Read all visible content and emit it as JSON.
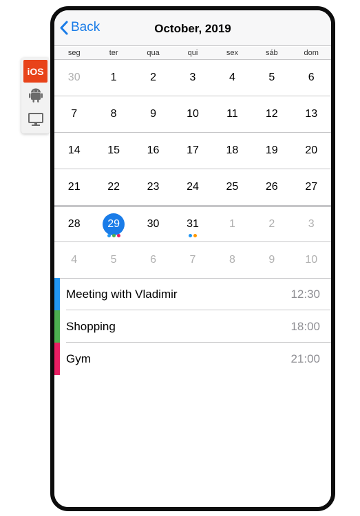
{
  "platforms": [
    {
      "label": "iOS",
      "icon": "ios-label",
      "active": true
    },
    {
      "label": "",
      "icon": "android-icon",
      "active": false
    },
    {
      "label": "",
      "icon": "desktop-icon",
      "active": false
    }
  ],
  "navbar": {
    "back_label": "Back",
    "title": "October, 2019"
  },
  "week_days": [
    "seg",
    "ter",
    "qua",
    "qui",
    "sex",
    "sáb",
    "dom"
  ],
  "calendar": {
    "selected_day": "29",
    "rows": [
      [
        {
          "d": "30",
          "other": true
        },
        {
          "d": "1"
        },
        {
          "d": "2"
        },
        {
          "d": "3"
        },
        {
          "d": "4"
        },
        {
          "d": "5"
        },
        {
          "d": "6"
        }
      ],
      [
        {
          "d": "7"
        },
        {
          "d": "8"
        },
        {
          "d": "9"
        },
        {
          "d": "10"
        },
        {
          "d": "11"
        },
        {
          "d": "12"
        },
        {
          "d": "13"
        }
      ],
      [
        {
          "d": "14"
        },
        {
          "d": "15"
        },
        {
          "d": "16"
        },
        {
          "d": "17"
        },
        {
          "d": "18"
        },
        {
          "d": "19"
        },
        {
          "d": "20"
        }
      ],
      [
        {
          "d": "21"
        },
        {
          "d": "22"
        },
        {
          "d": "23"
        },
        {
          "d": "24"
        },
        {
          "d": "25"
        },
        {
          "d": "26"
        },
        {
          "d": "27"
        }
      ],
      [
        {
          "d": "28"
        },
        {
          "d": "29",
          "selected": true,
          "dots": [
            "#2196f3",
            "#4caf50",
            "#e91e63"
          ]
        },
        {
          "d": "30"
        },
        {
          "d": "31",
          "dots": [
            "#2196f3",
            "#ff9800"
          ]
        },
        {
          "d": "1",
          "other": true
        },
        {
          "d": "2",
          "other": true
        },
        {
          "d": "3",
          "other": true
        }
      ],
      [
        {
          "d": "4",
          "other": true
        },
        {
          "d": "5",
          "other": true
        },
        {
          "d": "6",
          "other": true
        },
        {
          "d": "7",
          "other": true
        },
        {
          "d": "8",
          "other": true
        },
        {
          "d": "9",
          "other": true
        },
        {
          "d": "10",
          "other": true
        }
      ]
    ]
  },
  "events": [
    {
      "title": "Meeting with Vladimir",
      "time": "12:30",
      "color": "#2196f3"
    },
    {
      "title": "Shopping",
      "time": "18:00",
      "color": "#4caf50"
    },
    {
      "title": "Gym",
      "time": "21:00",
      "color": "#e91e63"
    }
  ],
  "colors": {
    "accent": "#1a7ce8",
    "platform_active": "#e8431a"
  }
}
